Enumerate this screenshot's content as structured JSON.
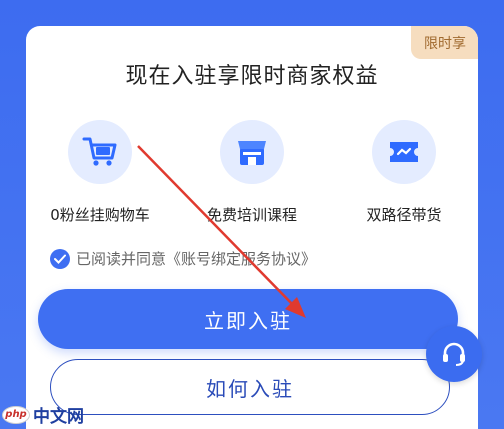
{
  "badge": "限时享",
  "title": "现在入驻享限时商家权益",
  "benefits": [
    {
      "label": "0粉丝挂购物车",
      "icon": "shopping-cart-icon"
    },
    {
      "label": "免费培训课程",
      "icon": "storefront-icon"
    },
    {
      "label": "双路径带货",
      "icon": "ticket-icon"
    }
  ],
  "agreement": {
    "prefix": "已阅读并同意",
    "link": "《账号绑定服务协议》",
    "checked": true
  },
  "buttons": {
    "primary": "立即入驻",
    "secondary": "如何入驻"
  },
  "watermark": {
    "logo": "php",
    "text": "中文网"
  },
  "colors": {
    "accent": "#3f6ff2",
    "badge_bg": "#f6ddbf",
    "arrow": "#e03a2f"
  }
}
